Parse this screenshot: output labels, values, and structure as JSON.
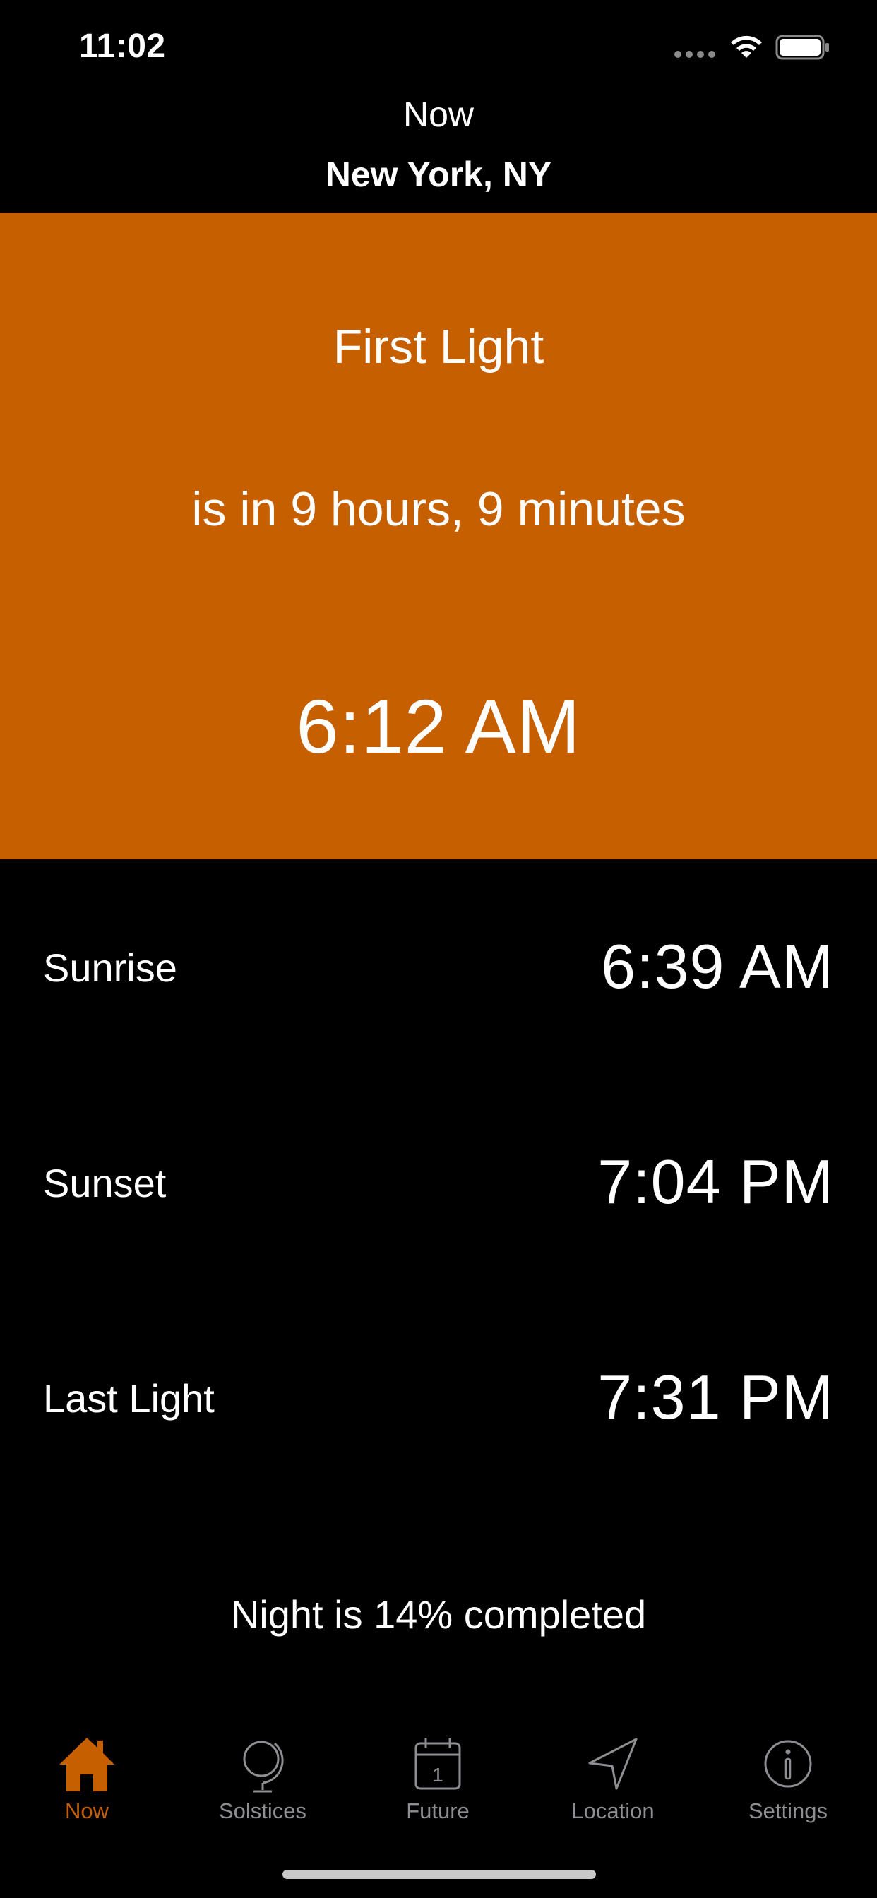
{
  "status_bar": {
    "time": "11:02"
  },
  "nav": {
    "title": "Now",
    "location": "New York, NY"
  },
  "hero": {
    "event": "First Light",
    "countdown": "is in 9 hours, 9 minutes",
    "time": "6:12 AM",
    "color": "#c55f00"
  },
  "rows": [
    {
      "label": "Sunrise",
      "time": "6:39 AM"
    },
    {
      "label": "Sunset",
      "time": "7:04 PM"
    },
    {
      "label": "Last Light",
      "time": "7:31 PM"
    }
  ],
  "progress_text": "Night is 14% completed",
  "tabs": [
    {
      "label": "Now",
      "icon": "house-icon",
      "active": true
    },
    {
      "label": "Solstices",
      "icon": "globe-icon",
      "active": false
    },
    {
      "label": "Future",
      "icon": "calendar-icon",
      "active": false
    },
    {
      "label": "Location",
      "icon": "location-arrow-icon",
      "active": false
    },
    {
      "label": "Settings",
      "icon": "info-icon",
      "active": false
    }
  ],
  "colors": {
    "accent": "#c55f00",
    "inactive_tab": "#8e8e93",
    "background": "#000000"
  }
}
